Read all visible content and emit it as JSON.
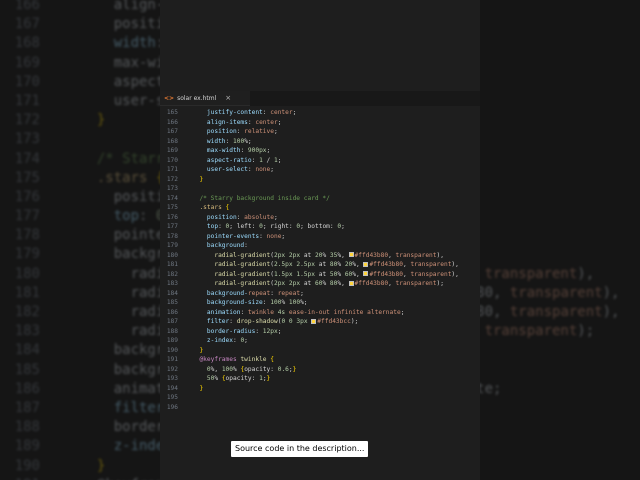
{
  "tab": {
    "icon": "<>",
    "name": "solar ex.html",
    "close": "×"
  },
  "editor_lines": [
    {
      "n": "165",
      "t": "    justify-content: center;"
    },
    {
      "n": "166",
      "t": "    align-items: center;"
    },
    {
      "n": "167",
      "t": "    position: relative;"
    },
    {
      "n": "168",
      "t": "    width: 100%;"
    },
    {
      "n": "169",
      "t": "    max-width: 900px;"
    },
    {
      "n": "170",
      "t": "    aspect-ratio: 1 / 1;"
    },
    {
      "n": "171",
      "t": "    user-select: none;"
    },
    {
      "n": "172",
      "t": "  }"
    },
    {
      "n": "173",
      "t": ""
    },
    {
      "n": "174",
      "t": "  /* Starry background inside card */"
    },
    {
      "n": "175",
      "t": "  .stars {"
    },
    {
      "n": "176",
      "t": "    position: absolute;"
    },
    {
      "n": "177",
      "t": "    top: 0; left: 0; right: 0; bottom: 0;"
    },
    {
      "n": "178",
      "t": "    pointer-events: none;"
    },
    {
      "n": "179",
      "t": "    background:"
    },
    {
      "n": "180",
      "t": "      radial-gradient(2px 2px at 20% 35%, #ffd43b80, transparent),"
    },
    {
      "n": "181",
      "t": "      radial-gradient(2.5px 2.5px at 80% 20%, #ffd43b80, transparent),"
    },
    {
      "n": "182",
      "t": "      radial-gradient(1.5px 1.5px at 50% 60%, #ffd43b80, transparent),"
    },
    {
      "n": "183",
      "t": "      radial-gradient(2px 2px at 60% 80%, #ffd43b80, transparent);"
    },
    {
      "n": "184",
      "t": "    background-repeat: repeat;"
    },
    {
      "n": "185",
      "t": "    background-size: 100% 100%;"
    },
    {
      "n": "186",
      "t": "    animation: twinkle 4s ease-in-out infinite alternate;"
    },
    {
      "n": "187",
      "t": "    filter: drop-shadow(0 0 3px #ffd43bcc);"
    },
    {
      "n": "188",
      "t": "    border-radius: 12px;"
    },
    {
      "n": "189",
      "t": "    z-index: 0;"
    },
    {
      "n": "190",
      "t": "  }"
    },
    {
      "n": "191",
      "t": "  @keyframes twinkle {"
    },
    {
      "n": "192",
      "t": "    0%, 100% {opacity: 0.6;}"
    },
    {
      "n": "193",
      "t": "    50% {opacity: 1;}"
    },
    {
      "n": "194",
      "t": "  }"
    },
    {
      "n": "195",
      "t": ""
    },
    {
      "n": "196",
      "t": ""
    }
  ],
  "background_lines": [
    {
      "n": "166",
      "t": "    align-ite"
    },
    {
      "n": "167",
      "t": "    position"
    },
    {
      "n": "168",
      "t": "    width: 10"
    },
    {
      "n": "169",
      "t": "    max-width"
    },
    {
      "n": "170",
      "t": "    aspect-ra"
    },
    {
      "n": "171",
      "t": "    user-sele"
    },
    {
      "n": "172",
      "t": "  }"
    },
    {
      "n": "173",
      "t": ""
    },
    {
      "n": "174",
      "t": "  /* Starry "
    },
    {
      "n": "175",
      "t": "  .stars {"
    },
    {
      "n": "176",
      "t": "    position"
    },
    {
      "n": "177",
      "t": "    top: 0; l"
    },
    {
      "n": "178",
      "t": "    pointer-e"
    },
    {
      "n": "179",
      "t": "    backgroun"
    },
    {
      "n": "180",
      "t": "      radial                                  , transparent),"
    },
    {
      "n": "181",
      "t": "      radial                                 3b80, transparent),"
    },
    {
      "n": "182",
      "t": "      radial                                 3b80, transparent),"
    },
    {
      "n": "183",
      "t": "      radial                                  , transparent);"
    },
    {
      "n": "184",
      "t": "    backgroun"
    },
    {
      "n": "185",
      "t": "    backgroun"
    },
    {
      "n": "186",
      "t": "    animation                                 ate;"
    },
    {
      "n": "187",
      "t": "    filter: d"
    },
    {
      "n": "188",
      "t": "    border-ra"
    },
    {
      "n": "189",
      "t": "    z-index: "
    },
    {
      "n": "190",
      "t": "  }"
    },
    {
      "n": "191",
      "t": "  @keyframes"
    }
  ],
  "caption": "Source code in the description..."
}
